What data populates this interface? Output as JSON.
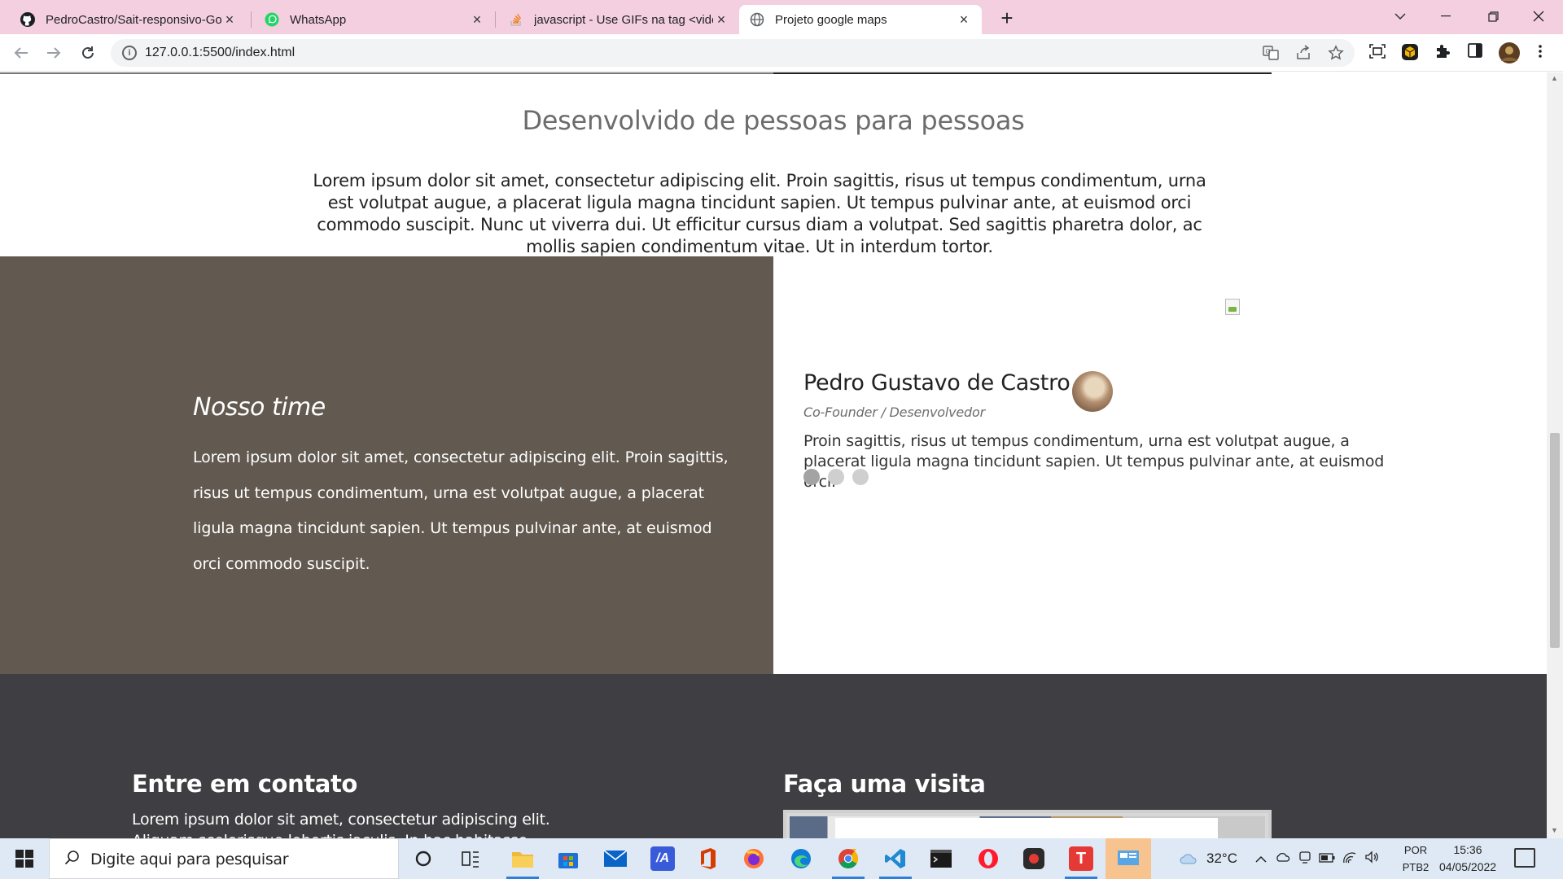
{
  "browser": {
    "tabs": [
      {
        "title": "PedroCastro/Sait-responsivo-Go",
        "icon": "github-icon",
        "active": false
      },
      {
        "title": "WhatsApp",
        "icon": "whatsapp-icon",
        "active": false
      },
      {
        "title": "javascript - Use GIFs na tag <vide",
        "icon": "stackoverflow-icon",
        "active": false
      },
      {
        "title": "Projeto google maps",
        "icon": "globe-icon",
        "active": true
      }
    ],
    "new_tab_label": "+",
    "url": "127.0.0.1:5500/index.html"
  },
  "about": {
    "title": "Desenvolvido de pessoas para pessoas",
    "text": "Lorem ipsum dolor sit amet, consectetur adipiscing elit. Proin sagittis, risus ut tempus condimentum, urna est volutpat augue, a placerat ligula magna tincidunt sapien. Ut tempus pulvinar ante, at euismod orci commodo suscipit. Nunc ut viverra dui. Ut efficitur cursus diam a volutpat. Sed sagittis pharetra dolor, ac mollis sapien condimentum vitae. Ut in interdum tortor."
  },
  "team": {
    "title": "Nosso time",
    "text": "Lorem ipsum dolor sit amet, consectetur adipiscing elit. Proin sagittis, risus ut tempus condimentum, urna est volutpat augue, a placerat ligula magna tincidunt sapien. Ut tempus pulvinar ante, at euismod orci commodo suscipit.",
    "member": {
      "name": "Pedro Gustavo de Castro",
      "role": "Co-Founder / Desenvolvedor",
      "quote": "Proin sagittis, risus ut tempus condimentum, urna est volutpat augue, a placerat ligula magna tincidunt sapien. Ut tempus pulvinar ante, at euismod orci."
    },
    "carousel_active_index": 0,
    "carousel_count": 3
  },
  "footer": {
    "contact_title": "Entre em contato",
    "contact_text": "Lorem ipsum dolor sit amet, consectetur adipiscing elit. Aliquam scelerisque lobortis iaculis. In hac habitasse",
    "visit_title": "Faça uma visita"
  },
  "taskbar": {
    "search_placeholder": "Digite aqui para pesquisar",
    "temperature": "32°C",
    "language_line1": "POR",
    "language_line2": "PTB2",
    "time": "15:36",
    "date": "04/05/2022"
  },
  "colors": {
    "tabstrip": "#f3cfe0",
    "team_panel": "#625950",
    "footer": "#3f3e42",
    "taskbar": "#dfe9f5"
  }
}
